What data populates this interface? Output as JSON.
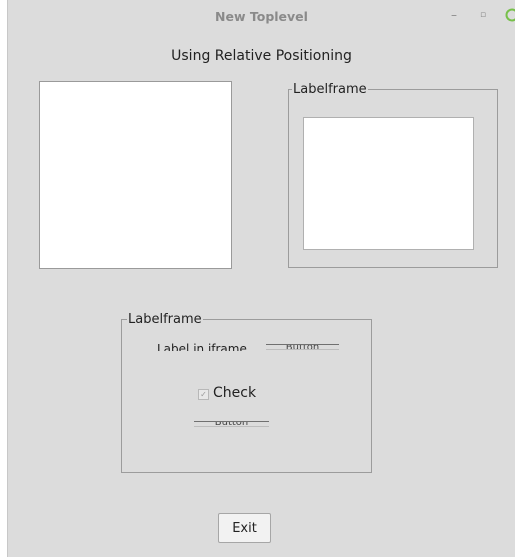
{
  "window": {
    "title": "New Toplevel",
    "controls": {
      "minimize": "–",
      "maximize": "▫",
      "close": ""
    }
  },
  "heading": "Using Relative Positioning",
  "labelframe_top": {
    "label": "Labelframe"
  },
  "labelframe_bottom": {
    "label": "Labelframe",
    "inner_label": "Label in iframe",
    "button_top_text": "Button",
    "check": {
      "label": "Check",
      "checked": true
    },
    "button_bottom_text": "Button"
  },
  "exit_button": "Exit",
  "colors": {
    "window_bg": "#dcdcdc",
    "close_icon": "#77c04a",
    "text": "#222222"
  }
}
